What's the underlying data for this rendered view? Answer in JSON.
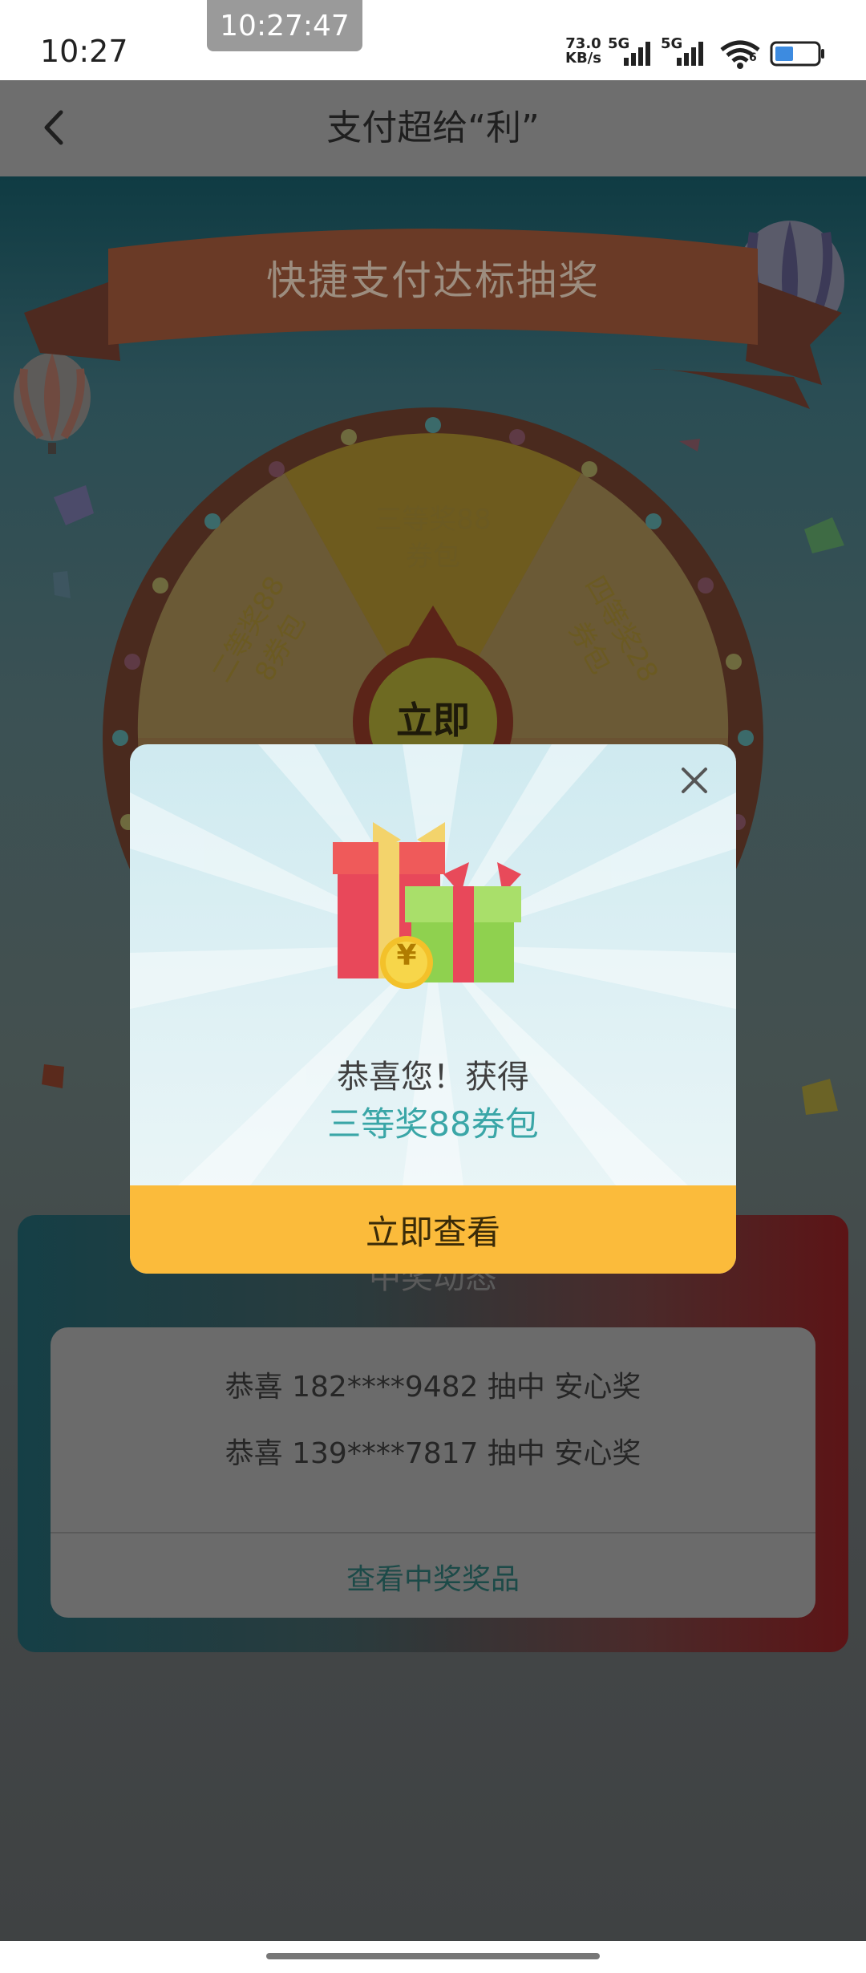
{
  "status_bar": {
    "time": "10:27",
    "clock_overlay": "10:27:47",
    "net_speed_value": "73.0",
    "net_speed_unit": "KB/s",
    "sim1": "5G",
    "sim2": "5G",
    "wifi_sub": "6",
    "icons": [
      "signal-icon",
      "signal-icon",
      "wifi-icon",
      "battery-icon"
    ]
  },
  "header": {
    "back_icon": "back-arrow-icon",
    "title": "支付超给“利”"
  },
  "game": {
    "banner": "快捷支付达标抽奖",
    "wheel_sectors": [
      {
        "line1": "三等奖88",
        "line2": "券包"
      },
      {
        "line1": "二等奖88",
        "line2": "8券包"
      },
      {
        "line1": "四等奖28",
        "line2": "券包"
      }
    ],
    "start_button": "立即"
  },
  "winners": {
    "title": "中奖动态",
    "items": [
      "恭喜 182****9482 抽中 安心奖",
      "恭喜 139****7817 抽中 安心奖"
    ],
    "link": "查看中奖奖品"
  },
  "modal": {
    "close_icon": "close-icon",
    "gift_icon": "gift-box-icon",
    "coin_symbol": "¥",
    "message": "恭喜您！获得",
    "prize": "三等奖88券包",
    "button": "立即查看"
  },
  "colors": {
    "accent_teal": "#3aa6a7",
    "button_yellow": "#fbbb3b"
  }
}
